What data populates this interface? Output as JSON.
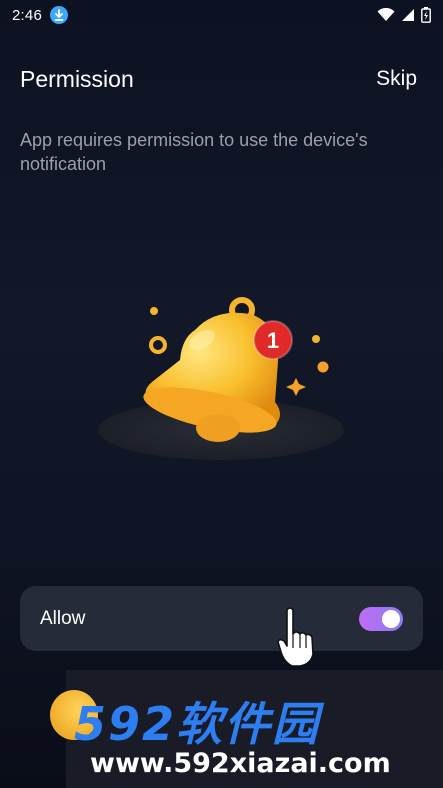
{
  "status_bar": {
    "time": "2:46",
    "icons": [
      "download-icon",
      "wifi-icon",
      "signal-icon",
      "battery-icon"
    ]
  },
  "header": {
    "title": "Permission",
    "skip_label": "Skip"
  },
  "description": "App requires permission to use the device's notification",
  "illustration": {
    "icon": "bell-icon",
    "badge_count": "1"
  },
  "allow_setting": {
    "label": "Allow",
    "enabled": true,
    "toggle_colors": [
      "#c06cf0",
      "#8c7cf8"
    ]
  },
  "watermark": {
    "brand": "592软件园",
    "url": "www.592xiazai.com"
  },
  "colors": {
    "background": "#121828",
    "card": "#262b3a",
    "muted_text": "#9aa0ab",
    "bell": "#f7b52a",
    "badge": "#e02a2a"
  }
}
